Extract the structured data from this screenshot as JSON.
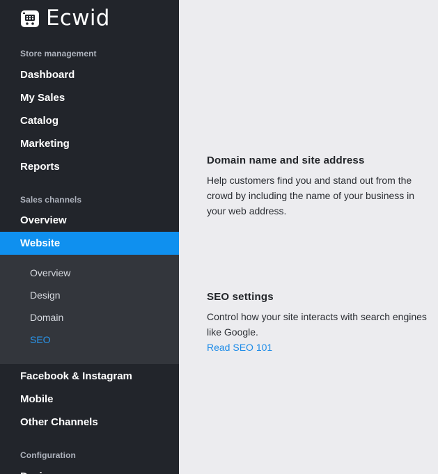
{
  "brand": {
    "name": "Ecwid"
  },
  "sidebar": {
    "store_section": "Store management",
    "store_items": [
      "Dashboard",
      "My Sales",
      "Catalog",
      "Marketing",
      "Reports"
    ],
    "sales_section": "Sales channels",
    "sales_items": [
      "Overview",
      "Website"
    ],
    "website_submenu": [
      "Overview",
      "Design",
      "Domain",
      "SEO"
    ],
    "more_sales_items": [
      "Facebook & Instagram",
      "Mobile",
      "Other Channels"
    ],
    "config_section": "Configuration",
    "config_items": [
      "Design"
    ]
  },
  "main": {
    "domain": {
      "title": "Domain name and site address",
      "description": "Help customers find you and stand out from the crowd by including the name of your business in your web address."
    },
    "seo": {
      "title": "SEO settings",
      "description": "Control how your site interacts with search engines like Google.",
      "link": "Read SEO 101"
    }
  },
  "colors": {
    "sidebar_bg": "#22252b",
    "active_item": "#0f90ef",
    "submenu_bg": "#33363c",
    "link": "#1e8ce8"
  }
}
